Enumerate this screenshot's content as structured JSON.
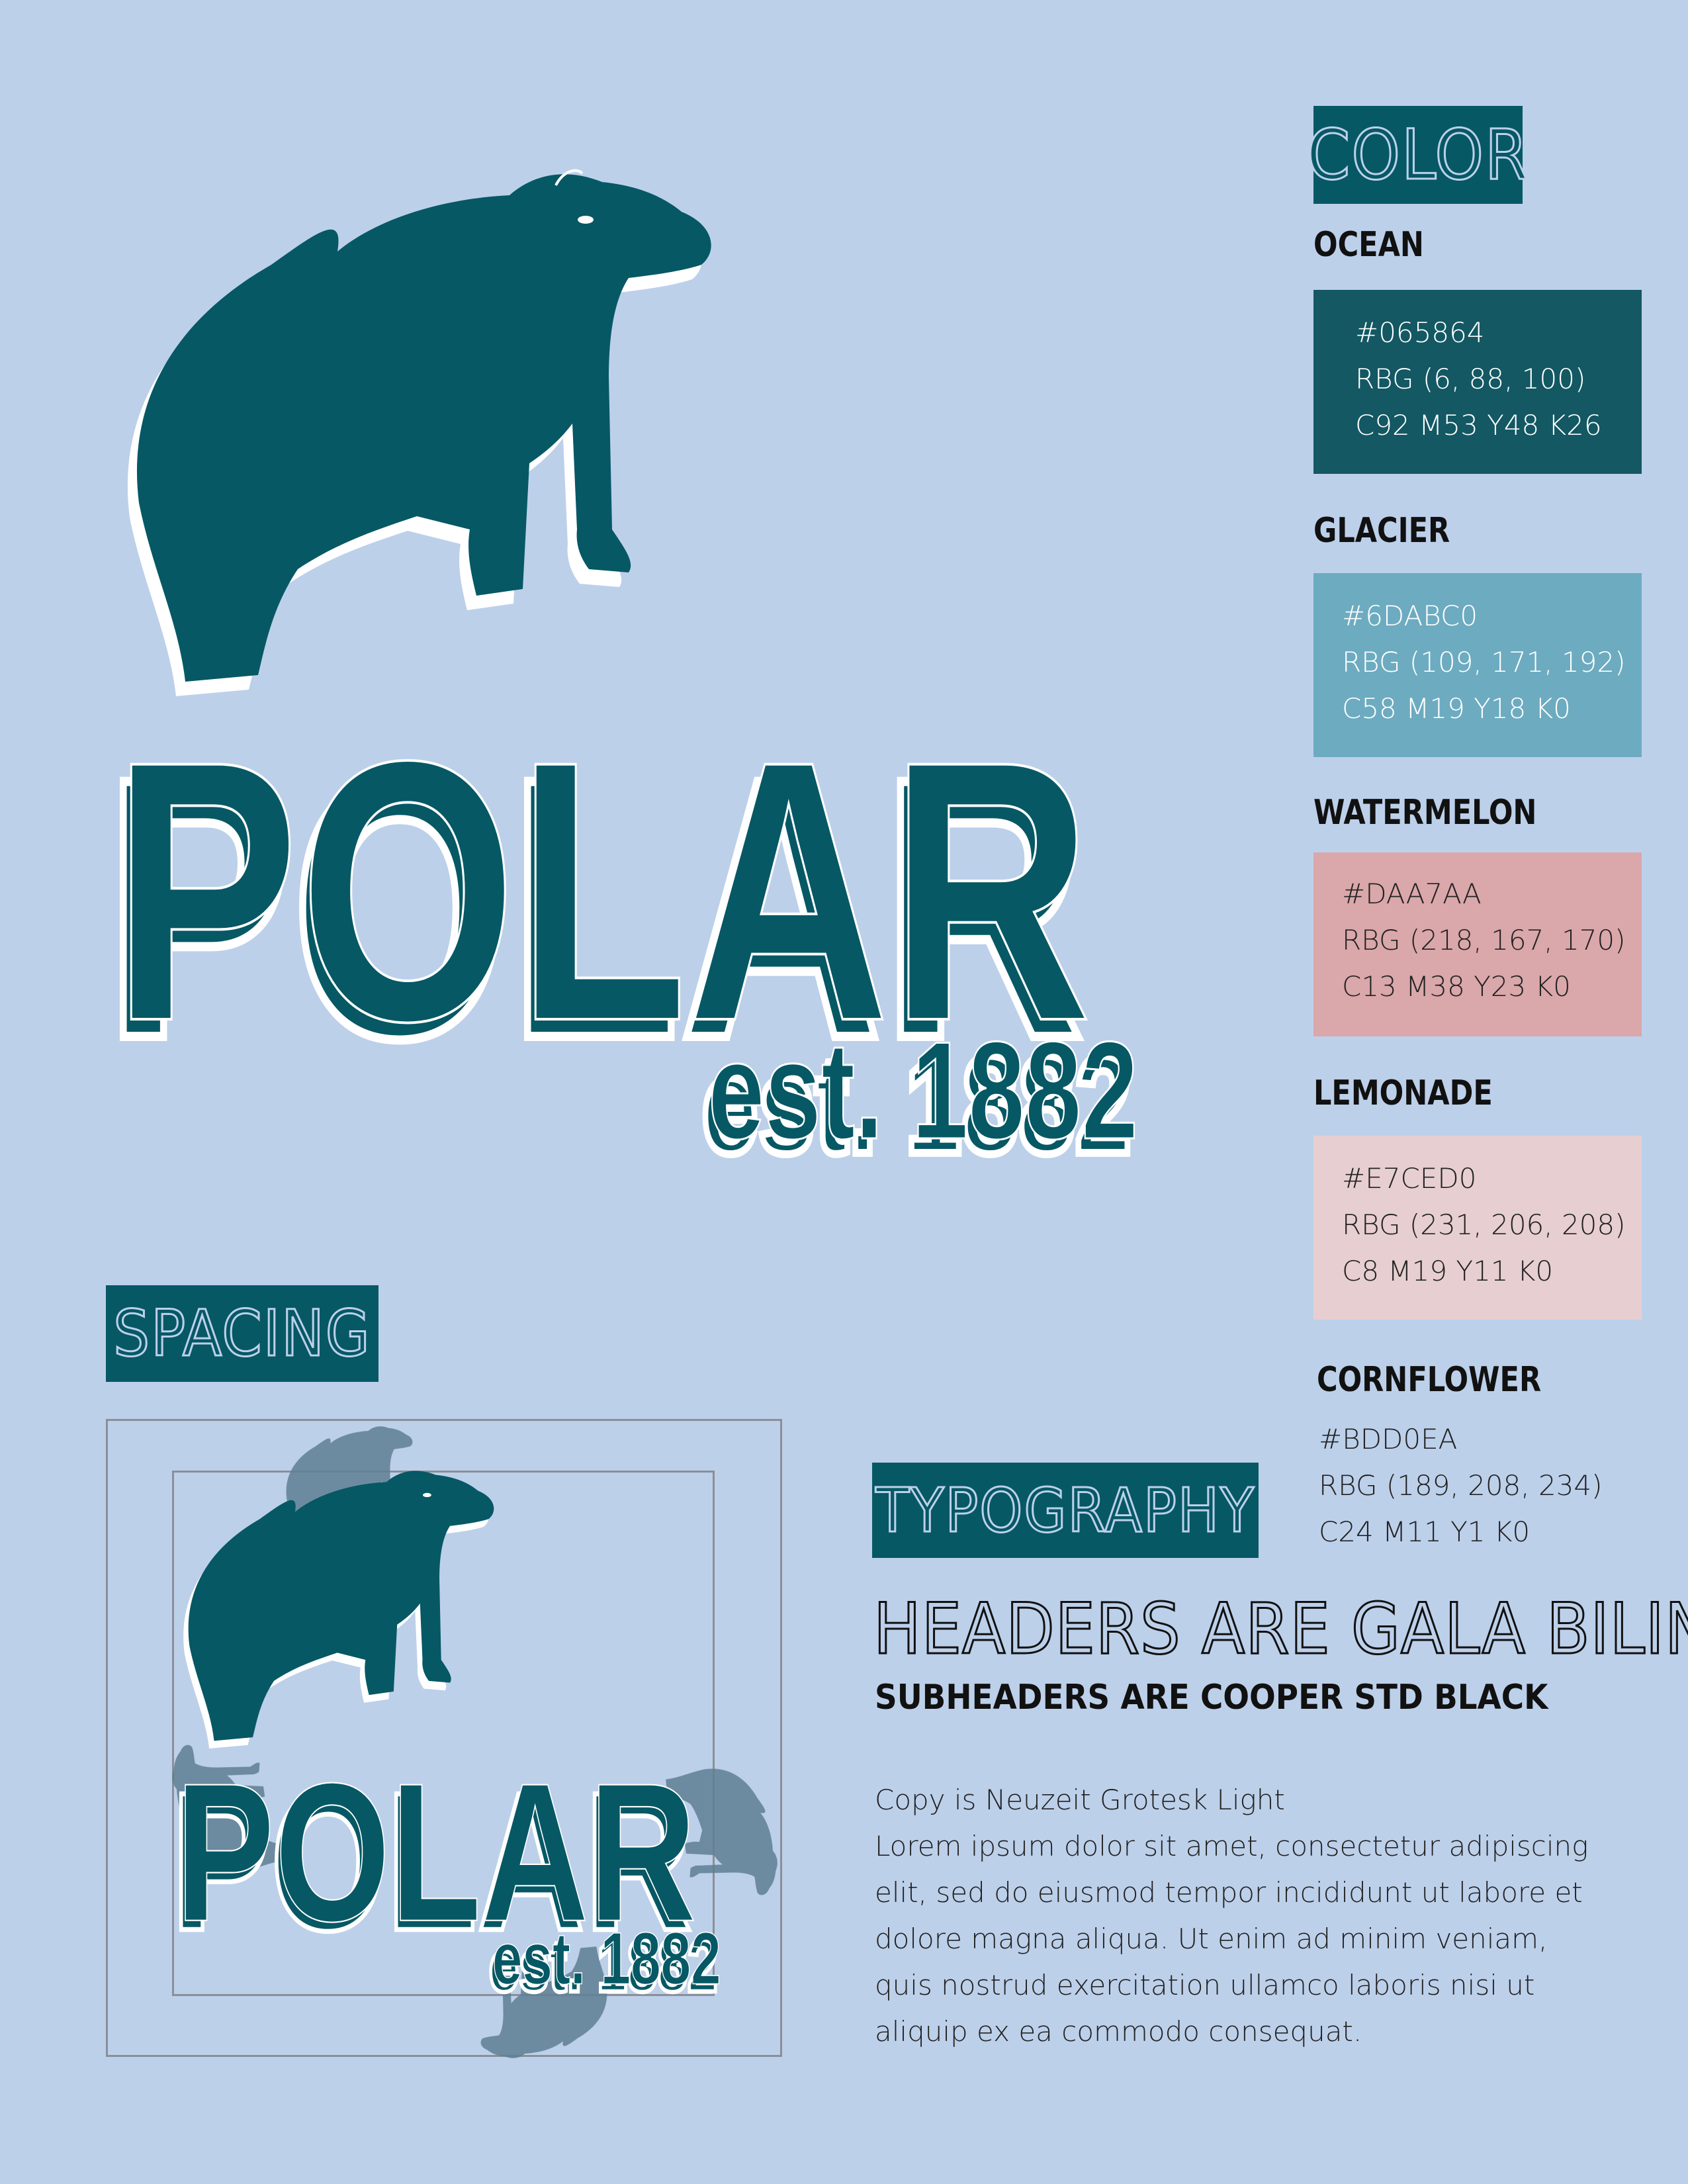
{
  "logo": {
    "wordmark": "POLAR",
    "tagline": "est. 1882"
  },
  "color_section": {
    "header": "COLOR",
    "swatches": [
      {
        "name": "OCEAN",
        "hex": "#065864",
        "rgb": "RBG (6, 88, 100)",
        "cmyk": "C92 M53 Y48 K26",
        "swatch_color": "#135863",
        "text_color": "#ffffff"
      },
      {
        "name": "GLACIER",
        "hex": "#6DABC0",
        "rgb": "RBG (109, 171, 192)",
        "cmyk": "C58 M19 Y18 K0",
        "swatch_color": "#6DABC0",
        "text_color": "#ffffff"
      },
      {
        "name": "WATERMELON",
        "hex": "#DAA7AA",
        "rgb": "RBG (218, 167, 170)",
        "cmyk": "C13 M38 Y23 K0",
        "swatch_color": "#DAA7AA",
        "text_color": "#222222"
      },
      {
        "name": "LEMONADE",
        "hex": "#E7CED0",
        "rgb": "RBG (231, 206, 208)",
        "cmyk": "C8 M19 Y11 K0",
        "swatch_color": "#E7CED0",
        "text_color": "#222222"
      },
      {
        "name": "CORNFLOWER",
        "hex": "#BDD0EA",
        "rgb": "RBG (189, 208, 234)",
        "cmyk": "C24 M11 Y1 K0",
        "swatch_color": "#BDD0EA",
        "text_color": "#222222"
      }
    ]
  },
  "spacing_section": {
    "header": "SPACING"
  },
  "typography_section": {
    "header": "TYPOGRAPHY",
    "header_sample": "HEADERS ARE GALA BILINE",
    "subheader_sample": "SUBHEADERS ARE COOPER STD BLACK",
    "copy_title": "Copy is Neuzeit Grotesk Light",
    "copy_lines": [
      "Lorem ipsum dolor sit amet, consectetur adipiscing",
      "elit, sed do eiusmod tempor incididunt ut labore et",
      "dolore magna aliqua. Ut enim ad minim veniam,",
      "quis nostrud exercitation ullamco laboris nisi ut",
      "aliquip ex ea commodo consequat."
    ]
  },
  "colors": {
    "page_background": "#BDD0EA",
    "brand": "#065864",
    "bear_shadow": "#5f7f93",
    "frame": "#8a8f97"
  }
}
